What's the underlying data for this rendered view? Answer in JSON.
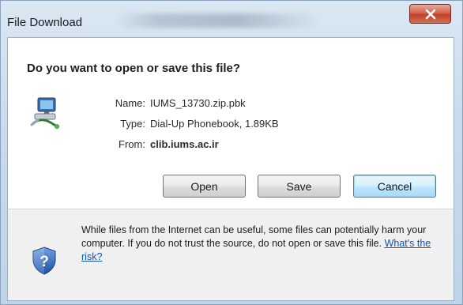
{
  "window": {
    "title": "File Download",
    "close_label": "x"
  },
  "dialog": {
    "question": "Do you want to open or save this file?",
    "file": {
      "name_label": "Name:",
      "name_value": "IUMS_13730.zip.pbk",
      "type_label": "Type:",
      "type_value": "Dial-Up Phonebook, 1.89KB",
      "from_label": "From:",
      "from_value": "clib.iums.ac.ir",
      "icon": "dial-up-phonebook-icon"
    },
    "buttons": {
      "open": "Open",
      "save": "Save",
      "cancel": "Cancel"
    }
  },
  "footer": {
    "icon": "security-shield-icon",
    "warning_text": "While files from the Internet can be useful, some files can potentially harm your computer. If you do not trust the source, do not open or save this file. ",
    "risk_link": "What's the risk?"
  },
  "colors": {
    "close_button": "#c94a33",
    "link": "#0b54b8",
    "default_button_border": "#3c7fb1"
  }
}
